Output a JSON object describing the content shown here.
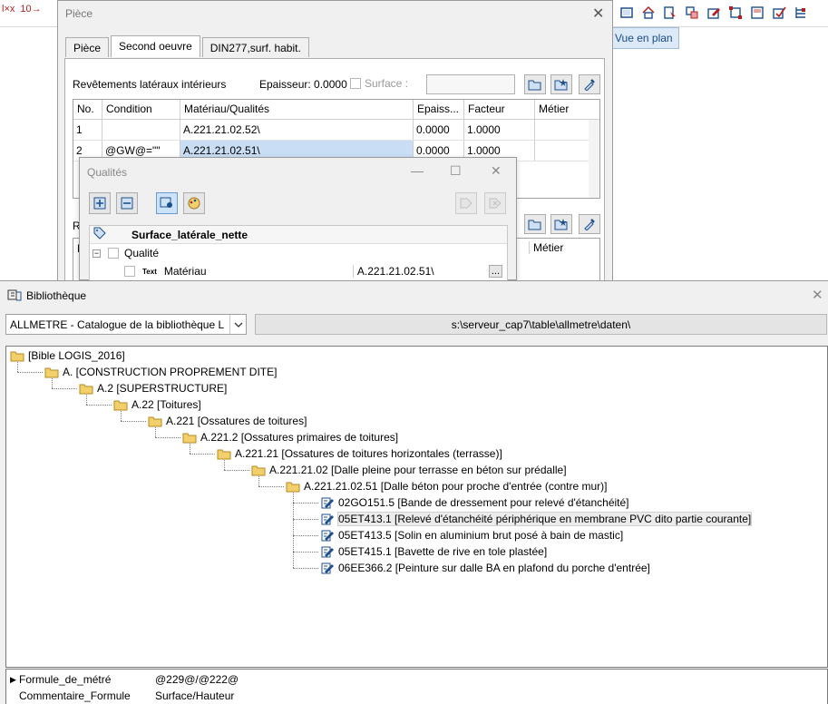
{
  "background_toolbar": {
    "left_icons": [
      "l×x",
      "10→"
    ],
    "right_icons": [
      "view-icon",
      "house-icon",
      "cursor-icon",
      "group-icon",
      "edit-icon",
      "frame-icon",
      "window-icon",
      "check-edit-icon",
      "layers-icon"
    ],
    "vue_en_plan": "Vue en plan"
  },
  "piece_dialog": {
    "title": "Pièce",
    "tabs": [
      {
        "label": "Pièce",
        "active": false
      },
      {
        "label": "Second oeuvre",
        "active": true
      },
      {
        "label": "DIN277,surf. habit.",
        "active": false
      }
    ],
    "section1_label": "Revêtements latéraux intérieurs",
    "epaisseur_label": "Epaisseur:",
    "epaisseur_value": "0.0000",
    "surface_label": "Surface :",
    "columns": [
      "No.",
      "Condition",
      "Matériau/Qualités",
      "Epaiss...",
      "Facteur",
      "Métier"
    ],
    "rows": [
      {
        "no": "1",
        "condition": "",
        "materiau": "A.221.21.02.52\\",
        "epaisseur": "0.0000",
        "facteur": "1.0000",
        "metier": ""
      },
      {
        "no": "2",
        "condition": "@GW@=\"\"",
        "materiau": "A.221.21.02.51\\",
        "epaisseur": "0.0000",
        "facteur": "1.0000",
        "metier": ""
      }
    ],
    "section2_label": "Re",
    "section2_col_first": "N",
    "section2_col_metier": "Métier"
  },
  "qualites_dialog": {
    "title": "Qualités",
    "header": "Surface_latérale_nette",
    "row_qualite": "Qualité",
    "row_materiau_type": "Text",
    "row_materiau_label": "Matériau",
    "row_materiau_value": "A.221.21.02.51\\",
    "ellipsis": "..."
  },
  "bibliotheque": {
    "title": "Bibliothèque",
    "catalog": "ALLMETRE - Catalogue de la bibliothèque L",
    "path": "s:\\serveur_cap7\\table\\allmetre\\daten\\",
    "tree": [
      {
        "label": "[Bible LOGIS_2016]",
        "level": 0,
        "kind": "folder"
      },
      {
        "label": "A. [CONSTRUCTION PROPREMENT DITE]",
        "level": 1,
        "kind": "folder"
      },
      {
        "label": "A.2 [SUPERSTRUCTURE]",
        "level": 2,
        "kind": "folder"
      },
      {
        "label": "A.22 [Toitures]",
        "level": 3,
        "kind": "folder"
      },
      {
        "label": "A.221 [Ossatures de toitures]",
        "level": 4,
        "kind": "folder"
      },
      {
        "label": "A.221.2 [Ossatures primaires de toitures]",
        "level": 5,
        "kind": "folder"
      },
      {
        "label": "A.221.21 [Ossatures de toitures horizontales (terrasse)]",
        "level": 6,
        "kind": "folder"
      },
      {
        "label": "A.221.21.02 [Dalle pleine pour terrasse en béton sur prédalle]",
        "level": 7,
        "kind": "folder"
      },
      {
        "label": "A.221.21.02.51 [Dalle béton pour proche d'entrée (contre mur)]",
        "level": 8,
        "kind": "folder"
      },
      {
        "label": "02GO151.5 [Bande de dressement pour relevé d'étanchéité]",
        "level": 9,
        "kind": "item"
      },
      {
        "label": "05ET413.1 [Relevé d'étanchéité périphérique en membrane PVC dito partie courante]",
        "level": 9,
        "kind": "item",
        "selected": true
      },
      {
        "label": "05ET413.5 [Solin en aluminium brut posé à bain de mastic]",
        "level": 9,
        "kind": "item"
      },
      {
        "label": "05ET415.1 [Bavette de rive en tole plastée]",
        "level": 9,
        "kind": "item"
      },
      {
        "label": "06EE366.2 [Peinture sur dalle BA en plafond du porche d'entrée]",
        "level": 9,
        "kind": "item"
      }
    ],
    "properties": [
      {
        "key": "Formule_de_métré",
        "value": "@229@/@222@",
        "current": true
      },
      {
        "key": "Commentaire_Formule",
        "value": "Surface/Hauteur",
        "current": false
      }
    ]
  },
  "colors": {
    "selection": "#c9def5",
    "folder": "#f2d06b",
    "window_bg": "#f0f0f0",
    "accent_blue": "#1a4c86"
  }
}
